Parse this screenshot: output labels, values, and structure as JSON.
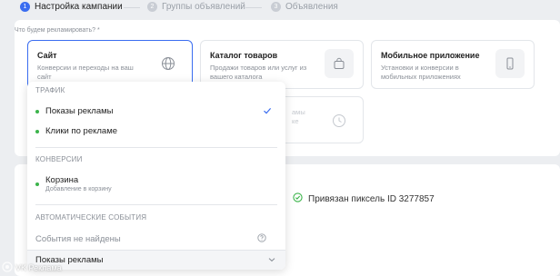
{
  "stepper": {
    "steps": [
      {
        "num": "1",
        "label": "Настройка кампании"
      },
      {
        "num": "2",
        "label": "Группы объявлений"
      },
      {
        "num": "3",
        "label": "Объявления"
      }
    ]
  },
  "campaign": {
    "question": "Что будем рекламировать? *",
    "options": [
      {
        "title": "Сайт",
        "desc": "Конверсии и переходы на ваш сайт",
        "icon": "globe-icon"
      },
      {
        "title": "Каталог товаров",
        "desc": "Продажи товаров или услуг из вашего каталога",
        "icon": "bag-icon"
      },
      {
        "title": "Мобильное приложение",
        "desc": "Установки и конверсии в мобильных приложениях",
        "icon": "phone-icon"
      }
    ],
    "ghost": {
      "line1": "амы",
      "line2": "ке",
      "icon": "clock-icon"
    }
  },
  "pixel": {
    "label": "Привязан пиксель ID 3277857",
    "icon": "check-circle-icon"
  },
  "dropdown": {
    "traffic_header": "ТРАФИК",
    "traffic_items": [
      {
        "label": "Показы рекламы",
        "selected": true
      },
      {
        "label": "Клики по рекламе",
        "selected": false
      }
    ],
    "conversions_header": "КОНВЕРСИИ",
    "conversion_item": {
      "label": "Корзина",
      "sub": "Добавление в корзину"
    },
    "auto_header": "АВТОМАТИЧЕСКИЕ СОБЫТИЯ",
    "auto_empty": "События не найдены",
    "selected_value": "Показы рекламы"
  },
  "watermark": {
    "text": "VK Реклама"
  },
  "colors": {
    "accent": "#3a6df0",
    "success": "#3cb44b",
    "background": "#eceef1"
  }
}
